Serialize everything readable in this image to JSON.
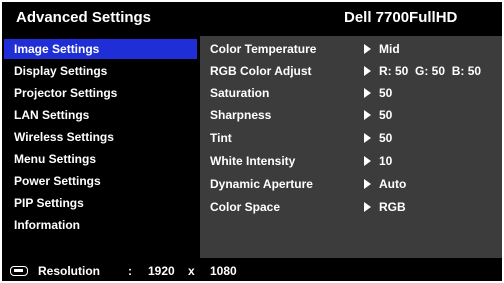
{
  "header": {
    "title": "Advanced Settings",
    "model": "Dell 7700FullHD"
  },
  "menu": {
    "items": [
      {
        "label": "Image Settings",
        "selected": true
      },
      {
        "label": "Display Settings"
      },
      {
        "label": "Projector Settings"
      },
      {
        "label": "LAN Settings"
      },
      {
        "label": "Wireless Settings"
      },
      {
        "label": "Menu Settings"
      },
      {
        "label": "Power Settings"
      },
      {
        "label": "PIP Settings"
      },
      {
        "label": "Information"
      }
    ]
  },
  "params": [
    {
      "label": "Color Temperature",
      "value": "Mid"
    },
    {
      "label": "RGB Color Adjust",
      "value": "R: 50  G: 50  B: 50"
    },
    {
      "label": "Saturation",
      "value": "50"
    },
    {
      "label": "Sharpness",
      "value": "50"
    },
    {
      "label": "Tint",
      "value": "50"
    },
    {
      "label": "White Intensity",
      "value": "10"
    },
    {
      "label": "Dynamic Aperture",
      "value": "Auto"
    },
    {
      "label": "Color Space",
      "value": "RGB"
    }
  ],
  "status": {
    "label": "Resolution",
    "separator": ":",
    "width": "1920",
    "times": "x",
    "height": "1080"
  },
  "colors": {
    "selected": "#1f2ed6",
    "panel": "#3c3c3c",
    "background": "#000000"
  },
  "icons": {
    "resolution": "input-connector-icon",
    "value_arrow": "arrow-right-icon"
  }
}
